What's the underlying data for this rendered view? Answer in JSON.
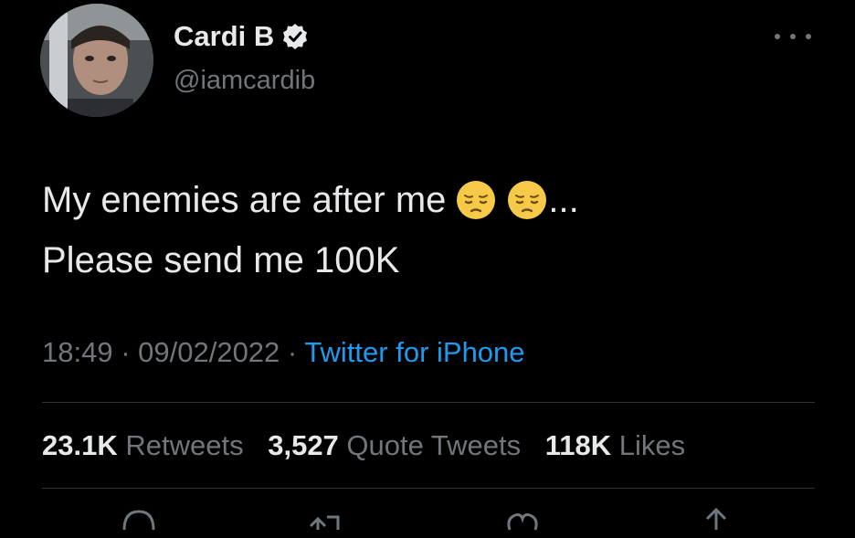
{
  "user": {
    "display_name": "Cardi B",
    "handle": "@iamcardib",
    "verified_icon": "verified-badge-icon",
    "avatar": "profile-avatar"
  },
  "tweet": {
    "line1_text": "My enemies are after me",
    "line1_suffix": "...",
    "line2_text": "Please send me 100K",
    "emoji": "pensive-face-emoji"
  },
  "meta": {
    "time": "18:49",
    "separator": "·",
    "date": "09/02/2022",
    "source": "Twitter for iPhone"
  },
  "stats": {
    "retweets_count": "23.1K",
    "retweets_label": "Retweets",
    "quotes_count": "3,527",
    "quotes_label": "Quote Tweets",
    "likes_count": "118K",
    "likes_label": "Likes"
  },
  "colors": {
    "background": "#000000",
    "text": "#e7e9ea",
    "secondary": "#71767b",
    "link": "#1d9bf0",
    "divider": "#2f3336"
  },
  "actions": [
    "reply-icon",
    "retweet-icon",
    "like-icon",
    "share-icon"
  ]
}
